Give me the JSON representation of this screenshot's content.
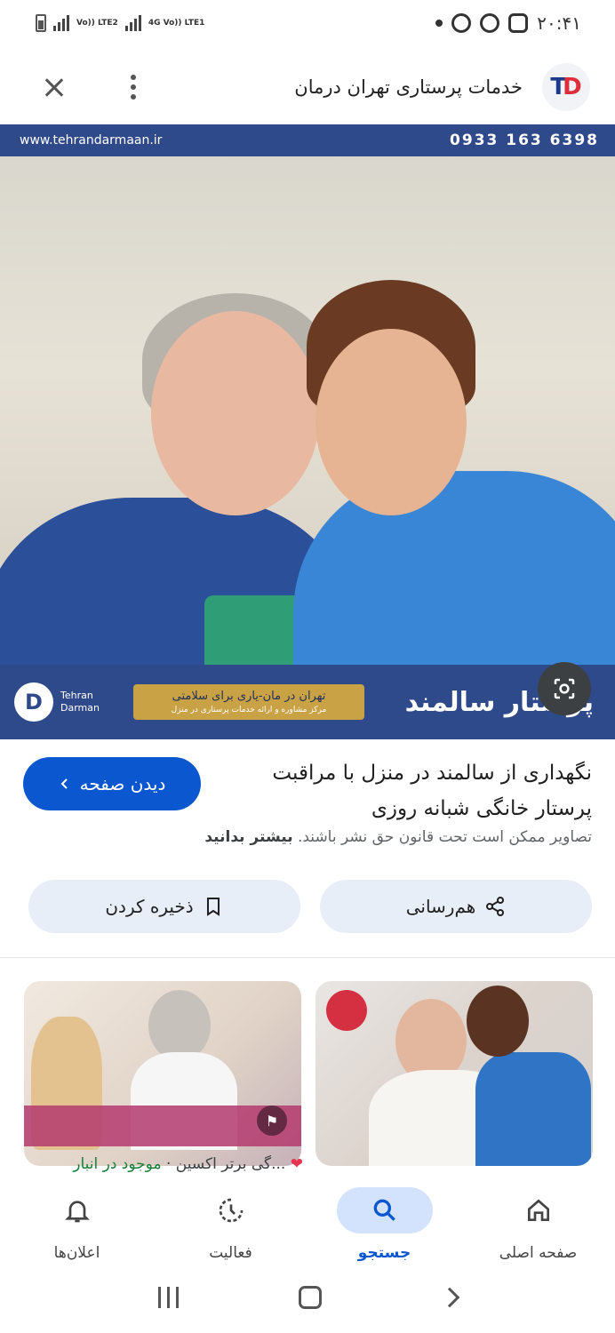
{
  "status_bar": {
    "time": "۲۰:۴۱",
    "network_1": "Vo)) LTE2",
    "network_2": "4G Vo)) LTE1"
  },
  "header": {
    "title": "خدمات پرستاری تهران درمان"
  },
  "hero": {
    "website": "www.tehrandarmaan.ir",
    "phone": "0933 163 6398",
    "brand_line1": "Tehran",
    "brand_line2": "Darman",
    "slogan": "تهران در مان-یاری برای سلامتی",
    "slogan_sub": "مرکز مشاوره و ارائه خدمات پرستاری در منزل",
    "image_title": "پرستار سالمند"
  },
  "result": {
    "visit_label": "دیدن صفحه",
    "title": "نگهداری از سالمند در منزل با مراقبت پرستار خانگی شبانه روزی",
    "copyright_text": "تصاویر ممکن است تحت قانون حق نشر باشند.",
    "learn_more": "بیشتر بدانید"
  },
  "actions": {
    "share_label": "هم‌رسانی",
    "save_label": "ذخیره کردن"
  },
  "related": {
    "left_caption_brand": "...گی برتر اکسین",
    "left_caption_stock": "موجود در انبار"
  },
  "bottom_nav": {
    "items": [
      {
        "label": "صفحه اصلی",
        "icon": "home-icon"
      },
      {
        "label": "جستجو",
        "icon": "search-icon"
      },
      {
        "label": "فعالیت",
        "icon": "activity-icon"
      },
      {
        "label": "اعلان‌ها",
        "icon": "bell-icon"
      }
    ]
  },
  "colors": {
    "accent": "#0b57d0",
    "pill_bg": "#e8eef8",
    "nav_active_bg": "#d3e3fd",
    "stock_green": "#188038"
  }
}
